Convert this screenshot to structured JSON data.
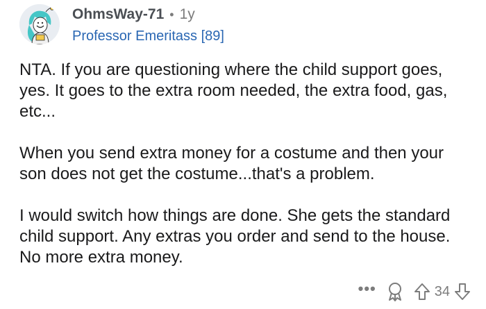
{
  "comment": {
    "username": "OhmsWay-71",
    "separator": "•",
    "age": "1y",
    "flair": "Professor Emeritass [89]",
    "paragraphs": [
      "NTA.  If you are questioning where the child support goes, yes.  It goes to the extra room needed, the extra food, gas, etc...",
      "When you send extra money for a costume and then your son does not get the costume...that's a problem.",
      "I would switch how things are done.  She gets the standard child support.  Any extras you order and send to the house.  No more extra money."
    ],
    "actions": {
      "more": "•••",
      "vote_count": "34"
    }
  },
  "colors": {
    "username": "#4b4f54",
    "flair": "#2a67b3",
    "meta": "#7c7c7c",
    "body_text": "#1a1a1b"
  },
  "icons": [
    "avatar",
    "more-options-icon",
    "award-icon",
    "upvote-icon",
    "downvote-icon"
  ]
}
